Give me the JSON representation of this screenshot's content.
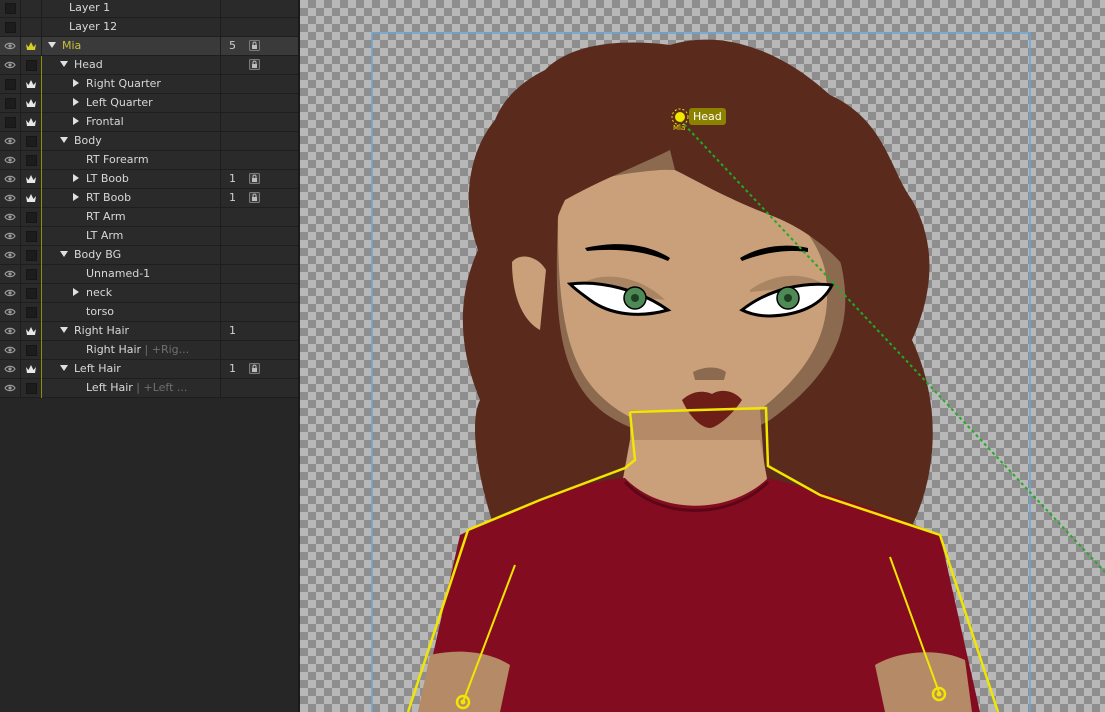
{
  "layers": [
    {
      "name": "Layer 1",
      "indent": 0,
      "eye": false,
      "crown": false,
      "twisty": "none",
      "count": "",
      "lock": false,
      "selected": false,
      "gold": false,
      "suffix": ""
    },
    {
      "name": "Layer 12",
      "indent": 0,
      "eye": false,
      "crown": false,
      "twisty": "none",
      "count": "",
      "lock": false,
      "selected": false,
      "gold": false,
      "suffix": ""
    },
    {
      "name": "Mia",
      "indent": 0,
      "eye": true,
      "crown": true,
      "twisty": "down",
      "count": "5",
      "lock": true,
      "selected": true,
      "gold": true,
      "suffix": ""
    },
    {
      "name": "Head",
      "indent": 1,
      "eye": true,
      "crown": false,
      "twisty": "down",
      "count": "",
      "lock": true,
      "selected": false,
      "gold": false,
      "suffix": ""
    },
    {
      "name": "Right Quarter",
      "indent": 2,
      "eye": false,
      "crown": true,
      "twisty": "right",
      "count": "",
      "lock": false,
      "selected": false,
      "gold": false,
      "suffix": ""
    },
    {
      "name": "Left Quarter",
      "indent": 2,
      "eye": false,
      "crown": true,
      "twisty": "right",
      "count": "",
      "lock": false,
      "selected": false,
      "gold": false,
      "suffix": ""
    },
    {
      "name": "Frontal",
      "indent": 2,
      "eye": false,
      "crown": true,
      "twisty": "right",
      "count": "",
      "lock": false,
      "selected": false,
      "gold": false,
      "suffix": ""
    },
    {
      "name": "Body",
      "indent": 1,
      "eye": true,
      "crown": false,
      "twisty": "down",
      "count": "",
      "lock": false,
      "selected": false,
      "gold": false,
      "suffix": ""
    },
    {
      "name": "RT Forearm",
      "indent": 2,
      "eye": true,
      "crown": false,
      "twisty": "none",
      "count": "",
      "lock": false,
      "selected": false,
      "gold": false,
      "suffix": ""
    },
    {
      "name": "LT Boob",
      "indent": 2,
      "eye": true,
      "crown": true,
      "twisty": "right",
      "count": "1",
      "lock": true,
      "selected": false,
      "gold": false,
      "suffix": ""
    },
    {
      "name": "RT Boob",
      "indent": 2,
      "eye": true,
      "crown": true,
      "twisty": "right",
      "count": "1",
      "lock": true,
      "selected": false,
      "gold": false,
      "suffix": ""
    },
    {
      "name": "RT Arm",
      "indent": 2,
      "eye": true,
      "crown": false,
      "twisty": "none",
      "count": "",
      "lock": false,
      "selected": false,
      "gold": false,
      "suffix": ""
    },
    {
      "name": "LT Arm",
      "indent": 2,
      "eye": true,
      "crown": false,
      "twisty": "none",
      "count": "",
      "lock": false,
      "selected": false,
      "gold": false,
      "suffix": ""
    },
    {
      "name": "Body BG",
      "indent": 1,
      "eye": true,
      "crown": false,
      "twisty": "down",
      "count": "",
      "lock": false,
      "selected": false,
      "gold": false,
      "suffix": ""
    },
    {
      "name": "Unnamed-1",
      "indent": 2,
      "eye": true,
      "crown": false,
      "twisty": "none",
      "count": "",
      "lock": false,
      "selected": false,
      "gold": false,
      "suffix": ""
    },
    {
      "name": "neck",
      "indent": 2,
      "eye": true,
      "crown": false,
      "twisty": "right",
      "count": "",
      "lock": false,
      "selected": false,
      "gold": false,
      "suffix": ""
    },
    {
      "name": "torso",
      "indent": 2,
      "eye": true,
      "crown": false,
      "twisty": "none",
      "count": "",
      "lock": false,
      "selected": false,
      "gold": false,
      "suffix": ""
    },
    {
      "name": "Right Hair",
      "indent": 1,
      "eye": true,
      "crown": true,
      "twisty": "down",
      "count": "1",
      "lock": false,
      "selected": false,
      "gold": false,
      "suffix": ""
    },
    {
      "name": "Right Hair",
      "indent": 2,
      "eye": true,
      "crown": false,
      "twisty": "none",
      "count": "",
      "lock": false,
      "selected": false,
      "gold": false,
      "suffix": " | +Rig..."
    },
    {
      "name": "Left Hair",
      "indent": 1,
      "eye": true,
      "crown": true,
      "twisty": "down",
      "count": "1",
      "lock": true,
      "selected": false,
      "gold": false,
      "suffix": ""
    },
    {
      "name": "Left Hair",
      "indent": 2,
      "eye": true,
      "crown": false,
      "twisty": "none",
      "count": "",
      "lock": false,
      "selected": false,
      "gold": false,
      "suffix": " | +Left ..."
    }
  ],
  "canvas": {
    "handle_label": "Head",
    "handle_sublabel": "Mia"
  },
  "colors": {
    "panel_bg": "#262626",
    "selected_text": "#c8c23a",
    "hair": "#5a2a1d",
    "skin": "#c9a07a",
    "shirt": "#840c20",
    "bone": "#f0e600",
    "guide_line": "#22aa22",
    "frame": "#6aa6d8"
  }
}
